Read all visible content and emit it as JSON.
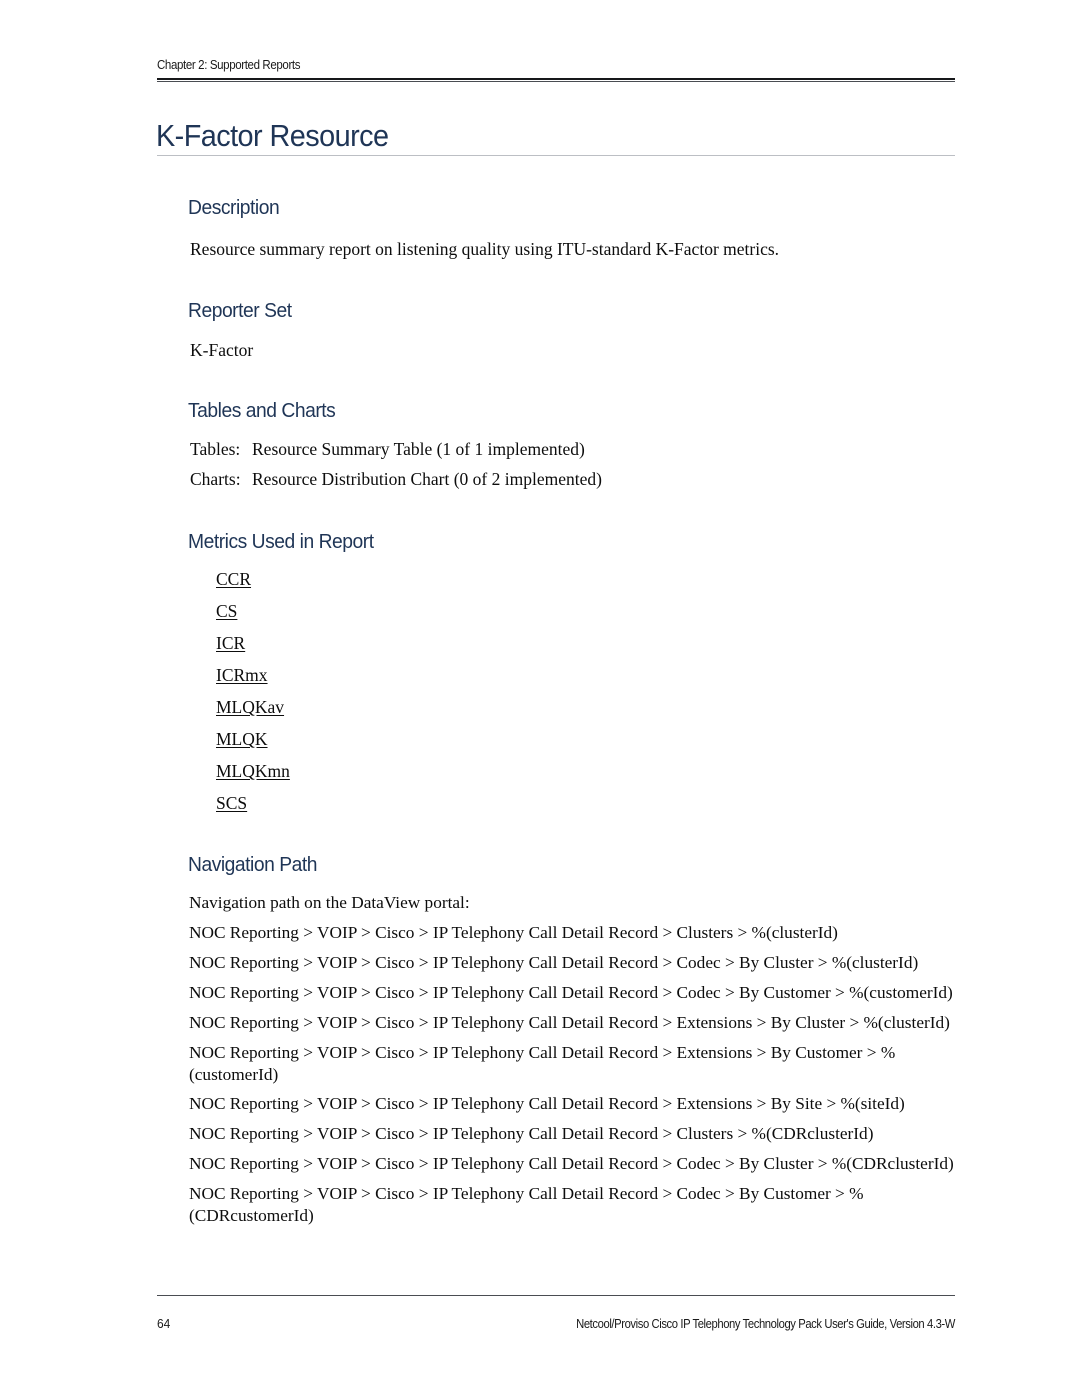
{
  "header": {
    "running_head": "Chapter 2: Supported Reports"
  },
  "title": "K-Factor Resource",
  "sections": {
    "description": {
      "heading": "Description",
      "text": "Resource summary report on listening quality using ITU-standard K-Factor metrics."
    },
    "reporter_set": {
      "heading": "Reporter Set",
      "text": "K-Factor"
    },
    "tables_and_charts": {
      "heading": "Tables and Charts",
      "rows": [
        {
          "label": "Tables:",
          "value": "Resource Summary Table (1 of 1 implemented)"
        },
        {
          "label": "Charts:",
          "value": "Resource Distribution Chart (0 of 2 implemented)"
        }
      ]
    },
    "metrics_used": {
      "heading": "Metrics Used in Report",
      "metrics": [
        "CCR",
        "CS",
        "ICR",
        "ICRmx",
        "MLQKav",
        "MLQK",
        "MLQKmn",
        "SCS "
      ]
    },
    "navigation_path": {
      "heading": "Navigation Path",
      "intro": "Navigation path on the DataView portal:",
      "paths": [
        "NOC Reporting >  VOIP >  Cisco >  IP Telephony Call Detail Record >  Clusters >  %(clusterId)",
        "NOC Reporting >  VOIP >  Cisco >  IP Telephony Call Detail Record >  Codec >  By Cluster >  %(clusterId)",
        "NOC Reporting >  VOIP >  Cisco >  IP Telephony Call Detail Record >  Codec >  By Customer >  %(customerId)",
        "NOC Reporting >  VOIP >  Cisco >  IP Telephony Call Detail Record >  Extensions >  By Cluster >  %(clusterId)",
        "NOC Reporting >  VOIP >  Cisco >  IP Telephony Call Detail Record >  Extensions >  By Customer >  %(customerId)",
        "NOC Reporting >  VOIP >  Cisco >  IP Telephony Call Detail Record >  Extensions >  By Site >  %(siteId)",
        "NOC Reporting >  VOIP >  Cisco >  IP Telephony Call Detail Record >  Clusters >  %(CDRclusterId)",
        "NOC Reporting >  VOIP >  Cisco >  IP Telephony Call Detail Record >  Codec >  By Cluster >  %(CDRclusterId)",
        "NOC Reporting >  VOIP >  Cisco >  IP Telephony Call Detail Record >  Codec >  By Customer >  %(CDRcustomerId)"
      ]
    }
  },
  "footer": {
    "page_number": "64",
    "note": "Netcool/Proviso Cisco IP Telephony Technology Pack User's Guide, Version 4.3-W"
  },
  "colors": {
    "heading_navy": "#1f3556",
    "body_black": "#0d0d0d",
    "rule_gray": "#bcbfc4"
  }
}
